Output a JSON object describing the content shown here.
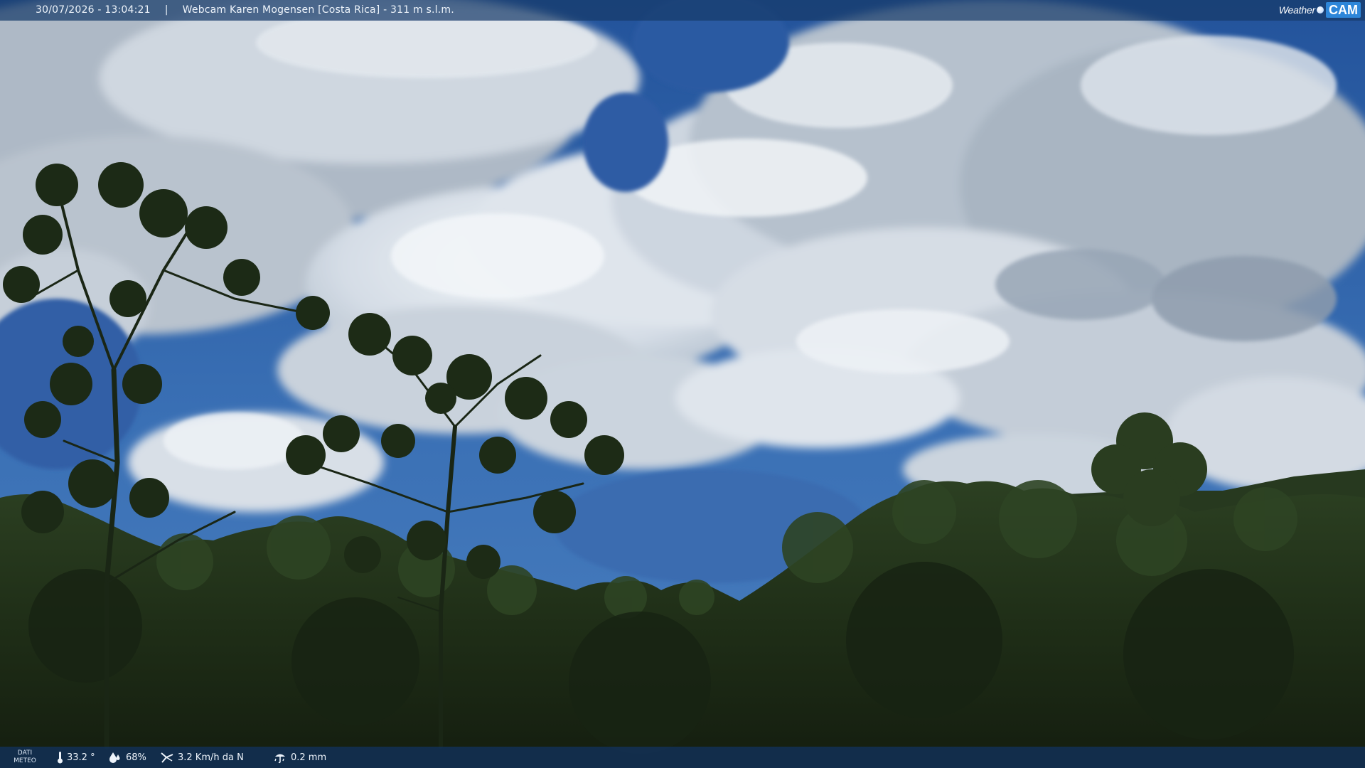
{
  "overlay_top": {
    "datetime": "30/07/2026 - 13:04:21",
    "separator": "|",
    "location": "Webcam Karen Mogensen [Costa Rica] - 311 m s.l.m."
  },
  "brand": {
    "part1": "Weather",
    "part2": "CAM"
  },
  "overlay_bottom": {
    "label_line1": "DATI",
    "label_line2": "METEO",
    "temperature": "33.2 °",
    "humidity": "68%",
    "wind": "3.2 Km/h da N",
    "rain": "0.2 mm"
  },
  "icons": {
    "temperature": "thermometer-icon",
    "humidity": "droplet-icon",
    "wind": "wind-icon",
    "rain": "rain-gauge-icon"
  },
  "colors": {
    "sky": "#2f63a8",
    "cloud": "#e8edf2",
    "forest": "#1e2d18",
    "bar": "#163a69"
  }
}
